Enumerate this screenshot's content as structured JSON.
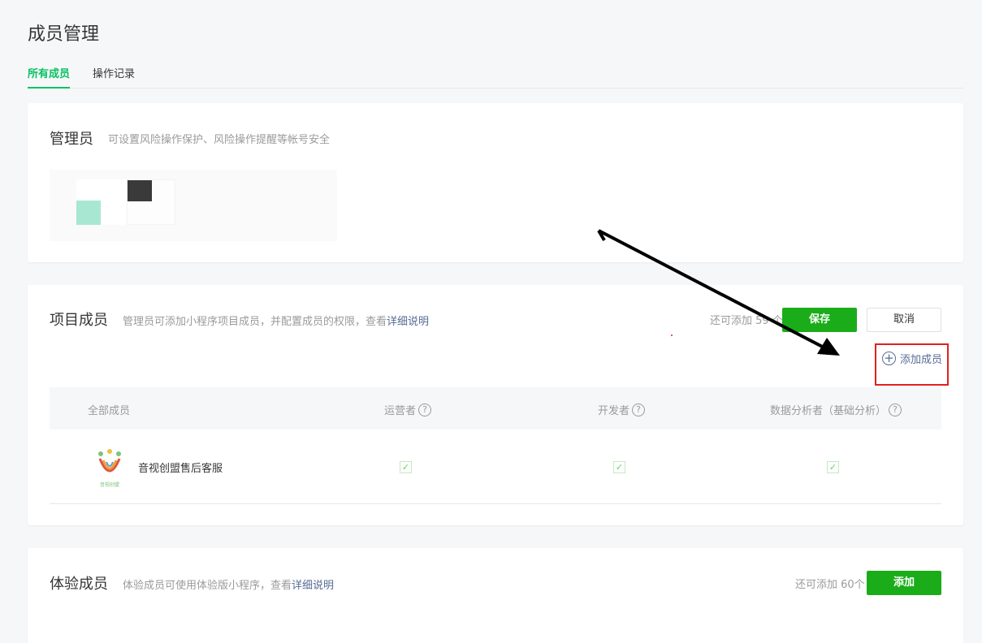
{
  "page_title": "成员管理",
  "tabs": [
    {
      "label": "所有成员",
      "active": true
    },
    {
      "label": "操作记录",
      "active": false
    }
  ],
  "admin": {
    "title": "管理员",
    "desc": "可设置风险操作保护、风险操作提醒等帐号安全"
  },
  "project": {
    "title": "项目成员",
    "desc_prefix": "管理员可添加小程序项目成员，并配置成员的权限，查看",
    "desc_link": "详细说明",
    "remain": "还可添加 59 个",
    "save_label": "保存",
    "cancel_label": "取消",
    "add_member_label": "添加成员",
    "columns": [
      "全部成员",
      "运营者",
      "开发者",
      "数据分析者（基础分析）"
    ],
    "members": [
      {
        "name": "音视创盟售后客服",
        "logo_caption": "音视创盟",
        "ops": true,
        "dev": true,
        "data": true
      }
    ]
  },
  "trial": {
    "title": "体验成员",
    "desc_prefix": "体验成员可使用体验版小程序，查看",
    "desc_link": "详细说明",
    "remain": "还可添加 60个",
    "add_label": "添加"
  },
  "colors": {
    "accent": "#07c160",
    "button_green": "#1aad19",
    "link": "#576b95",
    "highlight_box": "#e02020"
  }
}
